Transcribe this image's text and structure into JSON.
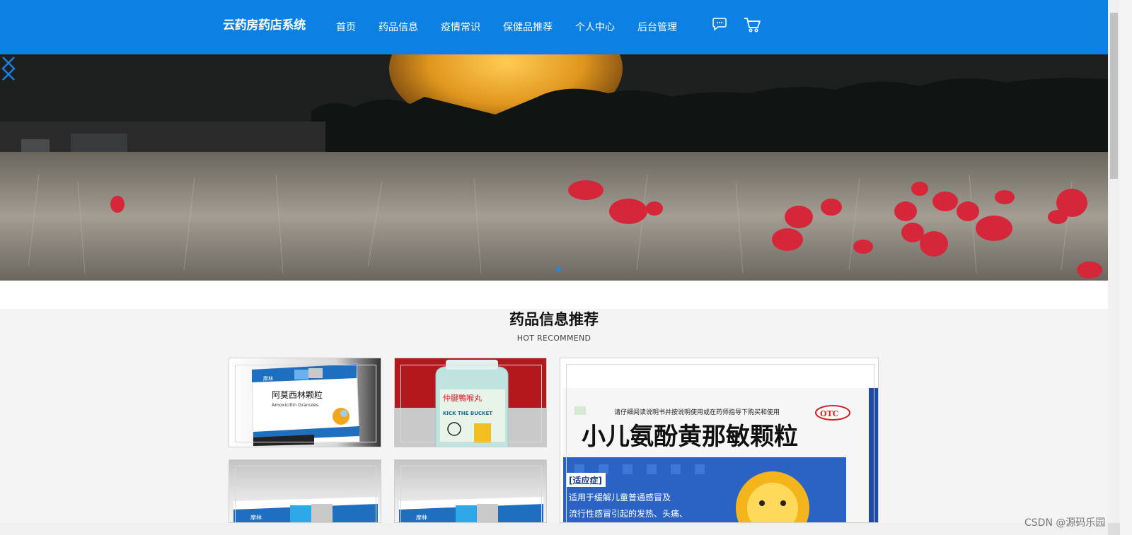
{
  "header": {
    "logo": "云药房药店系统",
    "nav": [
      "首页",
      "药品信息",
      "疫情常识",
      "保健品推荐",
      "个人中心",
      "后台管理"
    ],
    "icons": [
      "chat-icon",
      "cart-icon"
    ],
    "bg_color": "#0c81e3"
  },
  "banner": {
    "slide_count": 1,
    "active_slide": 1
  },
  "section": {
    "title": "药品信息推荐",
    "subtitle": "HOT RECOMMEND"
  },
  "products": [
    {
      "box_text": "阿莫西林颗粒",
      "box_sub": "Amoxicillin Granules",
      "brand": "摩林"
    },
    {
      "bottle_text": "仲腱鴨喉丸",
      "bottle_sub": "KICK THE BUCKET"
    },
    {
      "box_text": "小儿氨酚黄那敏颗粒",
      "top_line": "请仔细阅读说明书并按说明使用或在药师指导下购买和使用",
      "badge": "OTC",
      "tag": "[适应症]",
      "desc_1": "适用于缓解儿童普通感冒及",
      "desc_2": "流行性感冒引起的发热、头痛、"
    },
    {
      "brand": "摩林"
    },
    {
      "brand": "摩林"
    }
  ],
  "watermark": "CSDN @源码乐园"
}
